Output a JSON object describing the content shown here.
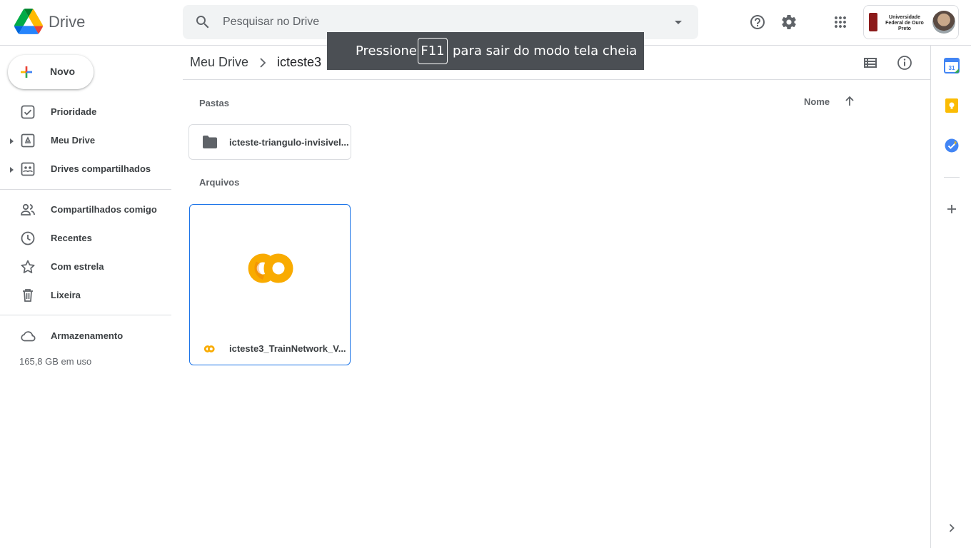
{
  "header": {
    "app_name": "Drive",
    "search_placeholder": "Pesquisar no Drive",
    "org_name": "Universidade Federal de Ouro Preto"
  },
  "sidebar": {
    "new_label": "Novo",
    "items": [
      {
        "label": "Prioridade",
        "icon": "check-square-icon"
      },
      {
        "label": "Meu Drive",
        "icon": "my-drive-icon"
      },
      {
        "label": "Drives compartilhados",
        "icon": "shared-drives-icon"
      },
      {
        "label": "Compartilhados comigo",
        "icon": "people-icon"
      },
      {
        "label": "Recentes",
        "icon": "clock-icon"
      },
      {
        "label": "Com estrela",
        "icon": "star-icon"
      },
      {
        "label": "Lixeira",
        "icon": "trash-icon"
      },
      {
        "label": "Armazenamento",
        "icon": "cloud-icon"
      }
    ],
    "storage_used": "165,8 GB em uso"
  },
  "breadcrumb": {
    "root": "Meu Drive",
    "current": "icteste3"
  },
  "content": {
    "folders_label": "Pastas",
    "files_label": "Arquivos",
    "sort_label": "Nome",
    "folders": [
      {
        "name": "icteste-triangulo-invisivel..."
      }
    ],
    "files": [
      {
        "name": "icteste3_TrainNetwork_V...",
        "type": "colab"
      }
    ]
  },
  "toast": {
    "prefix": "Pressione",
    "key": "F11",
    "suffix": "para sair do modo tela cheia"
  },
  "right_panel": {
    "calendar_day": "31"
  },
  "colors": {
    "accent": "#1a73e8",
    "colab_orange": "#F9AB00",
    "colab_yellow": "#E8710A",
    "keep_yellow": "#FBBC04",
    "tasks_blue": "#4285F4"
  }
}
